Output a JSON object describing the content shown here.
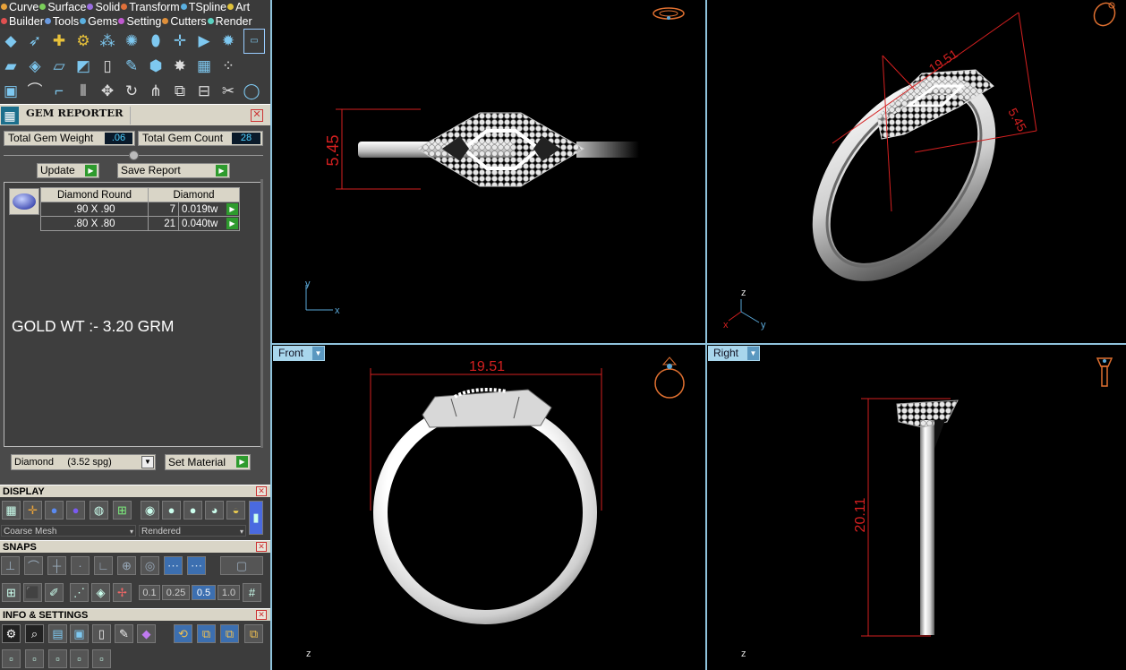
{
  "menu": {
    "row1": [
      {
        "label": "Curve",
        "color": "#e8a23a"
      },
      {
        "label": "Surface",
        "color": "#7bcf5a"
      },
      {
        "label": "Solid",
        "color": "#9a6ee0"
      },
      {
        "label": "Transform",
        "color": "#e0703a"
      },
      {
        "label": "TSpline",
        "color": "#5ab0e0"
      },
      {
        "label": "Art",
        "color": "#e0c23a"
      }
    ],
    "row2": [
      {
        "label": "Builder",
        "color": "#e05050"
      },
      {
        "label": "Tools",
        "color": "#6a9ae0"
      },
      {
        "label": "Gems",
        "color": "#5ab0e0"
      },
      {
        "label": "Setting",
        "color": "#c05ad0"
      },
      {
        "label": "Cutters",
        "color": "#e0903a"
      },
      {
        "label": "Render",
        "color": "#5ad0c0"
      }
    ]
  },
  "gem_reporter": {
    "title": "GEM REPORTER",
    "total_weight_label": "Total Gem Weight",
    "total_weight_value": ".06",
    "total_count_label": "Total Gem Count",
    "total_count_value": "28",
    "update_label": "Update",
    "save_report_label": "Save Report",
    "table": {
      "headers": [
        "Diamond Round",
        "Diamond"
      ],
      "rows": [
        {
          "size": ".90 X .90",
          "count": "7",
          "weight": "0.019tw"
        },
        {
          "size": ".80 X .80",
          "count": "21",
          "weight": "0.040tw"
        }
      ]
    },
    "note": "GOLD WT :- 3.20 GRM",
    "material_value": "Diamond     (3.52 spg)",
    "set_material_label": "Set Material"
  },
  "display": {
    "title": "DISPLAY",
    "mesh_value": "Coarse Mesh",
    "render_value": "Rendered"
  },
  "snaps": {
    "title": "SNAPS",
    "values": [
      "0.1",
      "0.25",
      "0.5",
      "1.0"
    ],
    "selected": "0.5"
  },
  "info": {
    "title": "INFO & SETTINGS"
  },
  "viewports": {
    "top_left": {
      "dimension": "5.45",
      "axis_x": "x",
      "axis_y": "y"
    },
    "top_right": {
      "dim_a": "19.51",
      "dim_b": "5.45",
      "axis_z": "z",
      "axis_x": "x",
      "axis_y": "y"
    },
    "bottom_left": {
      "tab": "Front",
      "dimension": "19.51",
      "axis": "z"
    },
    "bottom_right": {
      "tab": "Right",
      "dimension": "20.11",
      "axis": "z"
    }
  },
  "colors": {
    "dimension": "#d42020",
    "separator": "#8fc3dc",
    "tab_bg": "#a8d6ec",
    "panel_header": "#d9d5c7",
    "value_text": "#4fd0ff"
  }
}
